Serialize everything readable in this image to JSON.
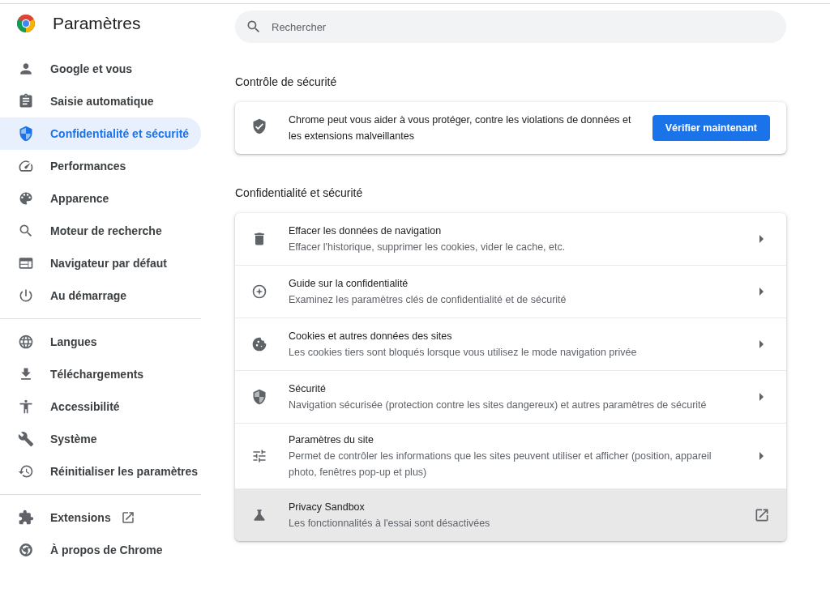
{
  "header": {
    "title": "Paramètres"
  },
  "sidebar": {
    "sections": [
      {
        "items": [
          {
            "label": "Google et vous",
            "selected": false
          },
          {
            "label": "Saisie automatique",
            "selected": false
          },
          {
            "label": "Confidentialité et sécurité",
            "selected": true
          },
          {
            "label": "Performances",
            "selected": false
          },
          {
            "label": "Apparence",
            "selected": false
          },
          {
            "label": "Moteur de recherche",
            "selected": false
          },
          {
            "label": "Navigateur par défaut",
            "selected": false
          },
          {
            "label": "Au démarrage",
            "selected": false
          }
        ]
      },
      {
        "items": [
          {
            "label": "Langues",
            "selected": false
          },
          {
            "label": "Téléchargements",
            "selected": false
          },
          {
            "label": "Accessibilité",
            "selected": false
          },
          {
            "label": "Système",
            "selected": false
          },
          {
            "label": "Réinitialiser les paramètres",
            "selected": false
          }
        ]
      },
      {
        "items": [
          {
            "label": "Extensions",
            "selected": false,
            "external": true
          },
          {
            "label": "À propos de Chrome",
            "selected": false
          }
        ]
      }
    ]
  },
  "search": {
    "placeholder": "Rechercher"
  },
  "safety_check": {
    "heading": "Contrôle de sécurité",
    "text": "Chrome peut vous aider à vous protéger, contre les violations de données et les extensions malveillantes",
    "button": "Vérifier maintenant"
  },
  "privacy": {
    "heading": "Confidentialité et sécurité",
    "rows": [
      {
        "title": "Effacer les données de navigation",
        "subtitle": "Effacer l'historique, supprimer les cookies, vider le cache, etc.",
        "kind": "arrow",
        "highlighted": false
      },
      {
        "title": "Guide sur la confidentialité",
        "subtitle": "Examinez les paramètres clés de confidentialité et de sécurité",
        "kind": "arrow",
        "highlighted": false
      },
      {
        "title": "Cookies et autres données des sites",
        "subtitle": "Les cookies tiers sont bloqués lorsque vous utilisez le mode navigation privée",
        "kind": "arrow",
        "highlighted": false
      },
      {
        "title": "Sécurité",
        "subtitle": "Navigation sécurisée (protection contre les sites dangereux) et autres paramètres de sécurité",
        "kind": "arrow",
        "highlighted": false
      },
      {
        "title": "Paramètres du site",
        "subtitle": "Permet de contrôler les informations que les sites peuvent utiliser et afficher (position, appareil photo, fenêtres pop-up et plus)",
        "kind": "arrow",
        "highlighted": false
      },
      {
        "title": "Privacy Sandbox",
        "subtitle": "Les fonctionnalités à l'essai sont désactivées",
        "kind": "external",
        "highlighted": true
      }
    ]
  }
}
